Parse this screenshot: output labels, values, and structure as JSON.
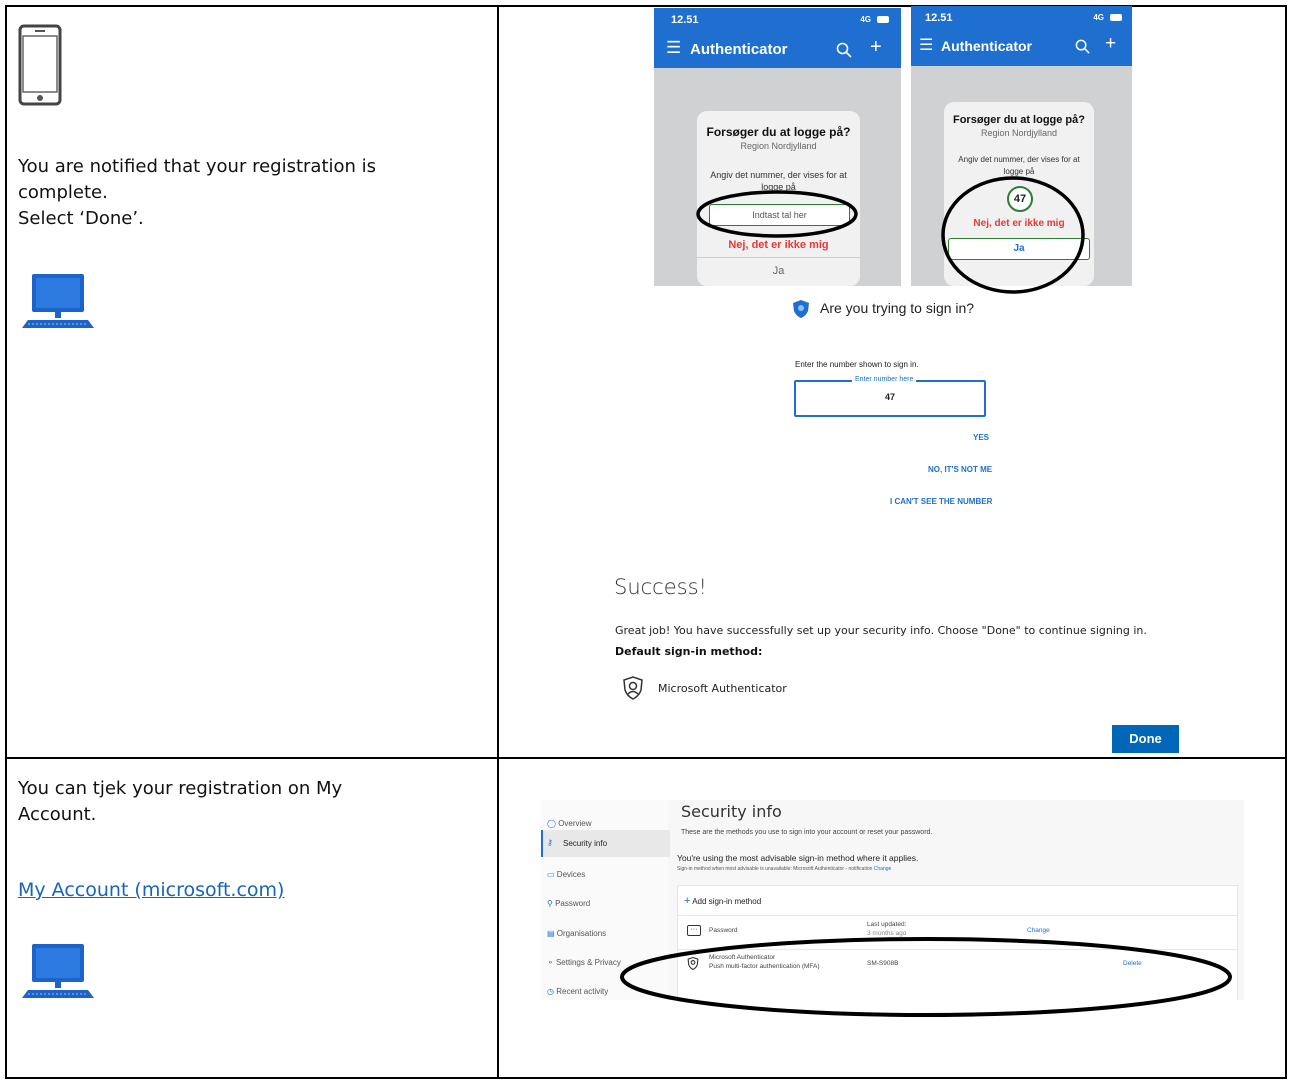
{
  "row1": {
    "left_text": [
      "You are notified that your registration is",
      "complete.",
      "Select ‘Done’."
    ],
    "icons": {
      "phone": "smartphone-icon",
      "computer": "computer-icon"
    },
    "phone1": {
      "time": "12.51",
      "signal": "4G",
      "app_title": "Authenticator",
      "prompt_title": "Forsøger du at logge på?",
      "prompt_org": "Region Nordjylland",
      "prompt_desc": "Angiv det nummer, der vises for at logge på",
      "input_placeholder": "Indtast tal her",
      "deny_label": "Nej, det er ikke mig",
      "accept_label": "Ja"
    },
    "phone2": {
      "time": "12.51",
      "signal": "4G",
      "app_title": "Authenticator",
      "prompt_title": "Forsøger du at logge på?",
      "prompt_org": "Region Nordjylland",
      "prompt_desc": "Angiv det nummer, der vises for at logge på",
      "number": "47",
      "deny_label": "Nej, det er ikke mig",
      "accept_label": "Ja"
    },
    "signin": {
      "question": "Are you trying to sign in?",
      "instruction": "Enter the number shown to sign in.",
      "field_label": "Enter number here",
      "field_value": "47",
      "yes": "YES",
      "no": "NO, IT'S NOT ME",
      "cant_see": "I CAN'T SEE THE NUMBER"
    },
    "success": {
      "title": "Success!",
      "message": "Great job! You have successfully set up your security info. Choose \"Done\" to continue signing in.",
      "default_label": "Default sign-in method:",
      "method": "Microsoft Authenticator",
      "done": "Done"
    }
  },
  "row2": {
    "left_text": [
      "You can tjek your registration on My",
      "Account."
    ],
    "link_text": "My Account (microsoft.com)",
    "icons": {
      "computer": "computer-icon"
    },
    "security": {
      "nav": [
        "Overview",
        "Security info",
        "Devices",
        "Password",
        "Organisations",
        "Settings & Privacy",
        "Recent activity"
      ],
      "title": "Security info",
      "subtitle": "These are the methods you use to sign into your account or reset your password.",
      "advice": "You're using the most advisable sign-in method where it applies.",
      "advice_small": "Sign-in method when most advisable is unavailable: Microsoft Authenticator - notification",
      "advice_change": "Change",
      "add_method": "Add sign-in method",
      "rows": [
        {
          "name": "Password",
          "detail": "",
          "col3a": "Last updated:",
          "col3b": "3 months ago",
          "action": "Change"
        },
        {
          "name": "Microsoft Authenticator",
          "detail": "Push multi-factor authentication (MFA)",
          "col3a": "SM-S908B",
          "col3b": "",
          "action": "Delete"
        }
      ]
    }
  },
  "colors": {
    "accent": "#0067b8",
    "phone_bar": "#1f6fd1",
    "deny": "#e53935",
    "highlight_green": "#2e7d32"
  }
}
